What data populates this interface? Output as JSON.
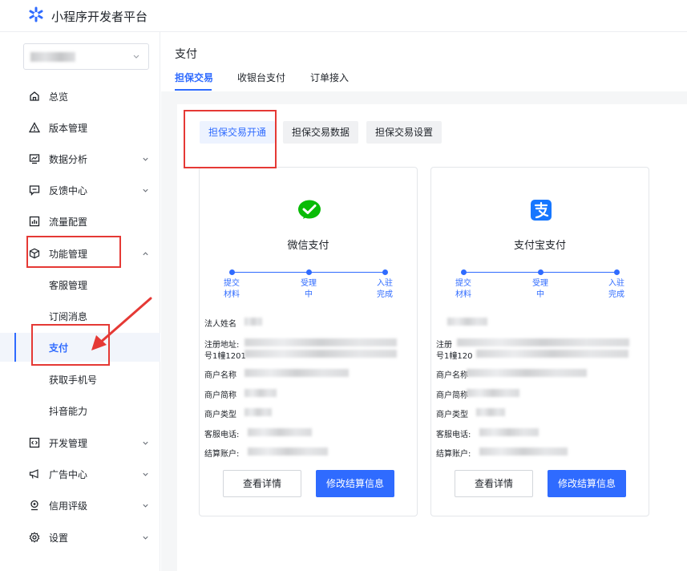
{
  "app": {
    "title": "小程序开发者平台"
  },
  "sidebar": {
    "nav": [
      {
        "label": "总览"
      },
      {
        "label": "版本管理"
      },
      {
        "label": "数据分析"
      },
      {
        "label": "反馈中心"
      },
      {
        "label": "流量配置"
      },
      {
        "label": "功能管理"
      },
      {
        "label": "开发管理"
      },
      {
        "label": "广告中心"
      },
      {
        "label": "信用评级"
      },
      {
        "label": "设置"
      }
    ],
    "sub": [
      {
        "label": "客服管理"
      },
      {
        "label": "订阅消息"
      },
      {
        "label": "支付"
      },
      {
        "label": "获取手机号"
      },
      {
        "label": "抖音能力"
      }
    ]
  },
  "page": {
    "title": "支付",
    "tabs": [
      {
        "label": "担保交易"
      },
      {
        "label": "收银台支付"
      },
      {
        "label": "订单接入"
      }
    ],
    "subtabs": [
      {
        "label": "担保交易开通"
      },
      {
        "label": "担保交易数据"
      },
      {
        "label": "担保交易设置"
      }
    ]
  },
  "cards": [
    {
      "name": "微信支付",
      "steps": [
        "提交\n材料",
        "受理\n中",
        "入驻\n完成"
      ],
      "fields": {
        "legal": "法人姓名",
        "addr": "注册地址:",
        "addr2": "号1幢1201",
        "mname": "商户名称",
        "mshort": "商户简称",
        "mtype": "商户类型",
        "phone": "客服电话:",
        "account": "结算账户:"
      },
      "buttons": {
        "detail": "查看详情",
        "modify": "修改结算信息"
      }
    },
    {
      "name": "支付宝支付",
      "steps": [
        "提交\n材料",
        "受理\n中",
        "入驻\n完成"
      ],
      "fields": {
        "legal": "",
        "addr": "注册",
        "addr2": "号1幢120",
        "mname": "商户名称",
        "mshort": "商户简称",
        "mtype": "商户类型",
        "phone": "客服电话:",
        "account": "结算账户:"
      },
      "buttons": {
        "detail": "查看详情",
        "modify": "修改结算信息"
      }
    }
  ],
  "colors": {
    "accent": "#2f6bff",
    "annotation": "#e53935",
    "wechat": "#09bb07",
    "alipay": "#1677ff"
  }
}
